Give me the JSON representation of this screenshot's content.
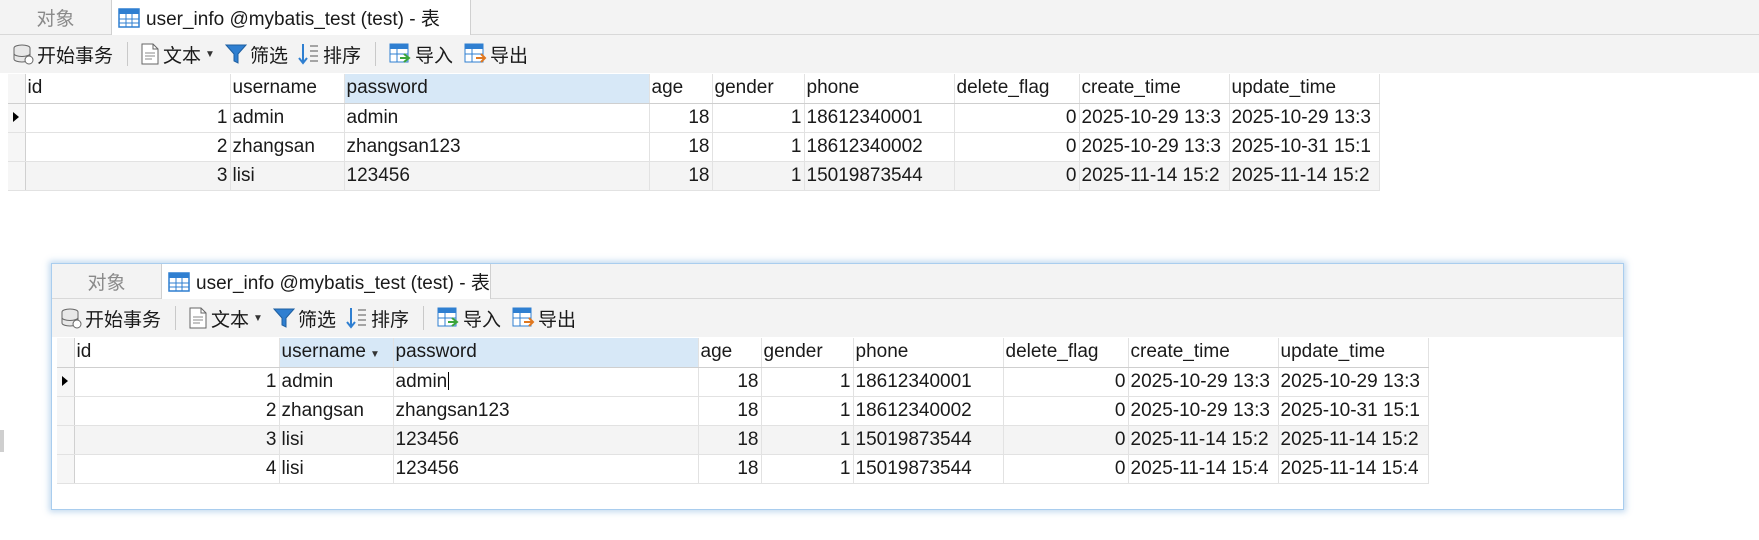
{
  "tabs": {
    "objects": "对象",
    "table": "user_info @mybatis_test (test) - 表"
  },
  "toolbar": {
    "begin_tx": "开始事务",
    "text": "文本",
    "filter": "筛选",
    "sort": "排序",
    "import": "导入",
    "export": "导出"
  },
  "columns": [
    "id",
    "username",
    "password",
    "age",
    "gender",
    "phone",
    "delete_flag",
    "create_time",
    "update_time"
  ],
  "grid1": {
    "rows": [
      [
        "1",
        "admin",
        "admin",
        "18",
        "1",
        "18612340001",
        "0",
        "2025-10-29 13:3",
        "2025-10-29 13:3"
      ],
      [
        "2",
        "zhangsan",
        "zhangsan123",
        "18",
        "1",
        "18612340002",
        "0",
        "2025-10-29 13:3",
        "2025-10-31 15:1"
      ],
      [
        "3",
        "lisi",
        "123456",
        "18",
        "1",
        "15019873544",
        "0",
        "2025-11-14 15:2",
        "2025-11-14 15:2"
      ]
    ]
  },
  "grid2": {
    "rows": [
      [
        "1",
        "admin",
        "admin",
        "18",
        "1",
        "18612340001",
        "0",
        "2025-10-29 13:3",
        "2025-10-29 13:3"
      ],
      [
        "2",
        "zhangsan",
        "zhangsan123",
        "18",
        "1",
        "18612340002",
        "0",
        "2025-10-29 13:3",
        "2025-10-31 15:1"
      ],
      [
        "3",
        "lisi",
        "123456",
        "18",
        "1",
        "15019873544",
        "0",
        "2025-11-14 15:2",
        "2025-11-14 15:2"
      ],
      [
        "4",
        "lisi",
        "123456",
        "18",
        "1",
        "15019873544",
        "0",
        "2025-11-14 15:4",
        "2025-11-14 15:4"
      ]
    ]
  },
  "icons": {
    "begin_tx": "database-icon",
    "text": "document-icon",
    "filter": "funnel-icon",
    "sort": "sort-icon",
    "import": "import-icon",
    "export": "export-icon",
    "table": "table-grid-icon"
  },
  "colors": {
    "accent": "#2f7fd1",
    "header_selected": "#d7e8f7",
    "panel_border": "#a9cdee"
  }
}
